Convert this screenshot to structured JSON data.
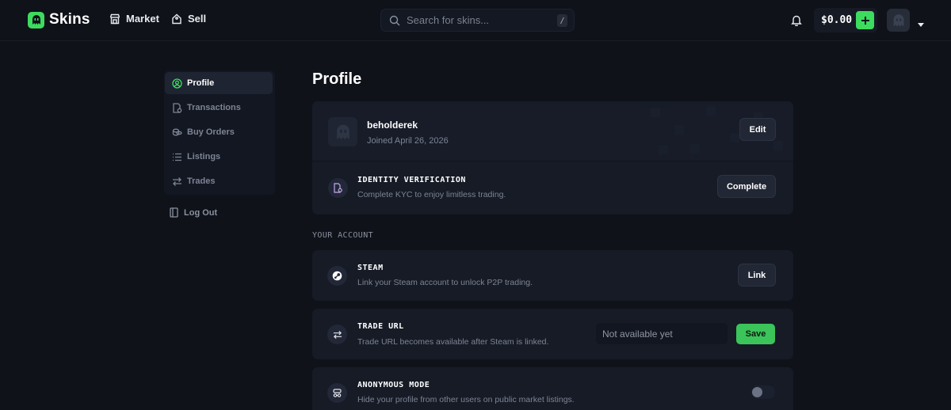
{
  "header": {
    "brand": "Skins",
    "nav": [
      {
        "label": "Market",
        "icon": "storefront-icon"
      },
      {
        "label": "Sell",
        "icon": "tag-icon"
      }
    ],
    "search": {
      "placeholder": "Search for skins...",
      "shortcut": "/"
    },
    "balance": "$0.00",
    "colors": {
      "accent": "#3ddc5f",
      "background": "#0f1219"
    }
  },
  "sidebar": {
    "items": [
      {
        "label": "Profile",
        "icon": "user-circle-icon",
        "active": true
      },
      {
        "label": "Transactions",
        "icon": "receipt-icon",
        "active": false
      },
      {
        "label": "Buy Orders",
        "icon": "coins-icon",
        "active": false
      },
      {
        "label": "Listings",
        "icon": "list-icon",
        "active": false
      },
      {
        "label": "Trades",
        "icon": "arrows-swap-icon",
        "active": false
      }
    ],
    "logout": "Log Out"
  },
  "main": {
    "title": "Profile",
    "profile": {
      "username": "beholderek",
      "joined": "Joined April 26, 2026",
      "edit_label": "Edit"
    },
    "identity": {
      "title": "IDENTITY VERIFICATION",
      "description": "Complete KYC to enjoy limitless trading.",
      "button": "Complete"
    },
    "section_label": "YOUR ACCOUNT",
    "steam": {
      "title": "STEAM",
      "description": "Link your Steam account to unlock P2P trading.",
      "button": "Link"
    },
    "trade_url": {
      "title": "TRADE URL",
      "description": "Trade URL becomes available after Steam is linked.",
      "value": "Not available yet",
      "button": "Save"
    },
    "anonymous": {
      "title": "ANONYMOUS MODE",
      "description": "Hide your profile from other users on public market listings.",
      "enabled": false
    }
  }
}
